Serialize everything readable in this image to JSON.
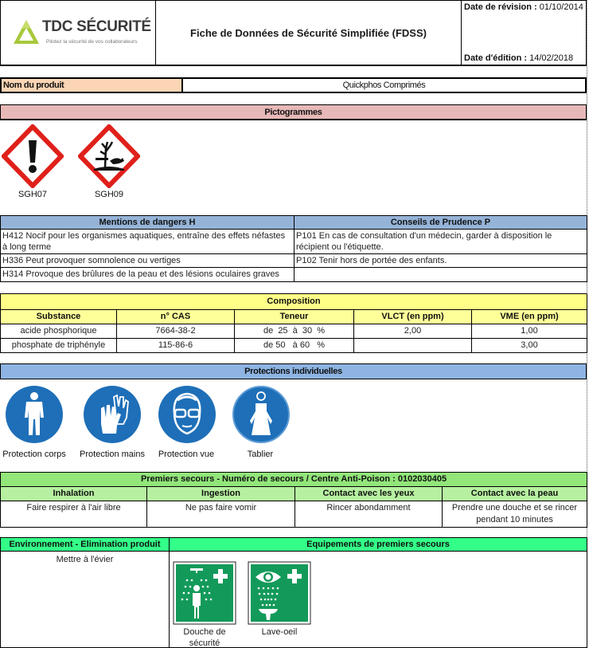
{
  "header": {
    "logo_name": "TDC SÉCURITÉ",
    "logo_tagline": "Pilotez la sécurité de vos collaborateurs",
    "title": "Fiche de Données de Sécurité Simplifiée (FDSS)",
    "revision_label": "Date de révision :",
    "revision_date": "01/10/2014",
    "edition_label": "Date d'édition :",
    "edition_date": "14/02/2018"
  },
  "product": {
    "label": "Nom du produit",
    "value": "Quickphos Comprimés"
  },
  "pictograms": {
    "title": "Pictogrammes",
    "items": [
      {
        "code": "SGH07",
        "icon": "exclamation-mark-icon"
      },
      {
        "code": "SGH09",
        "icon": "environment-hazard-icon"
      }
    ]
  },
  "hazards": {
    "h_title": "Mentions de dangers H",
    "p_title": "Conseils de Prudence P",
    "rows": [
      {
        "h": "H412 Nocif pour les organismes aquatiques, entraîne des effets néfastes à long terme",
        "p": "P101 En cas de consultation d'un médecin, garder à disposition le récipient ou l'étiquette."
      },
      {
        "h": "H336 Peut provoquer somnolence ou vertiges",
        "p": "P102 Tenir hors de portée des enfants."
      },
      {
        "h": "H314 Provoque des brûlures de la peau et des lésions oculaires graves",
        "p": ""
      }
    ]
  },
  "composition": {
    "title": "Composition",
    "columns": [
      "Substance",
      "n° CAS",
      "Teneur",
      "VLCT (en ppm)",
      "VME (en ppm)"
    ],
    "rows": [
      [
        "acide phosphorique",
        "7664-38-2",
        "de  25  à  30  %",
        "2,00",
        "1,00"
      ],
      [
        "phosphate de triphényle",
        "115-86-6",
        "de 50   à 60   %",
        "",
        "3,00"
      ]
    ]
  },
  "protections": {
    "title": "Protections individuelles",
    "items": [
      {
        "label": "Protection corps",
        "icon": "coverall-icon"
      },
      {
        "label": "Protection mains",
        "icon": "gloves-icon"
      },
      {
        "label": "Protection vue",
        "icon": "goggles-icon"
      },
      {
        "label": "Tablier",
        "icon": "apron-icon"
      }
    ]
  },
  "first_aid": {
    "title": "Premiers secours - Numéro de secours / Centre Anti-Poison : 0102030405",
    "columns": [
      "Inhalation",
      "Ingestion",
      "Contact avec les yeux",
      "Contact avec la peau"
    ],
    "values": [
      "Faire respirer à l'air libre",
      "Ne pas faire vomir",
      "Rincer abondamment",
      "Prendre une douche et se rincer pendant 10 minutes"
    ]
  },
  "environment": {
    "title": "Environnement - Elimination produit",
    "value": "Mettre à l'évier"
  },
  "equipment": {
    "title": "Equipements de premiers secours",
    "items": [
      {
        "label": "Douche de sécurité",
        "icon": "safety-shower-icon"
      },
      {
        "label": "Lave-oeil",
        "icon": "eyewash-icon"
      }
    ]
  },
  "colors": {
    "product_label_bg": "#fcd5b4",
    "pictogram_header_bg": "#e6b8b7",
    "hazard_header_bg": "#95b3d7",
    "composition_bg": "#ffff88",
    "protection_header_bg": "#8db4e2",
    "first_aid_bg": "#92e67a",
    "environment_bg": "#33ff88",
    "ghs_red": "#e0201a",
    "ppe_blue": "#1e6fb8",
    "safety_green": "#139a5a"
  }
}
